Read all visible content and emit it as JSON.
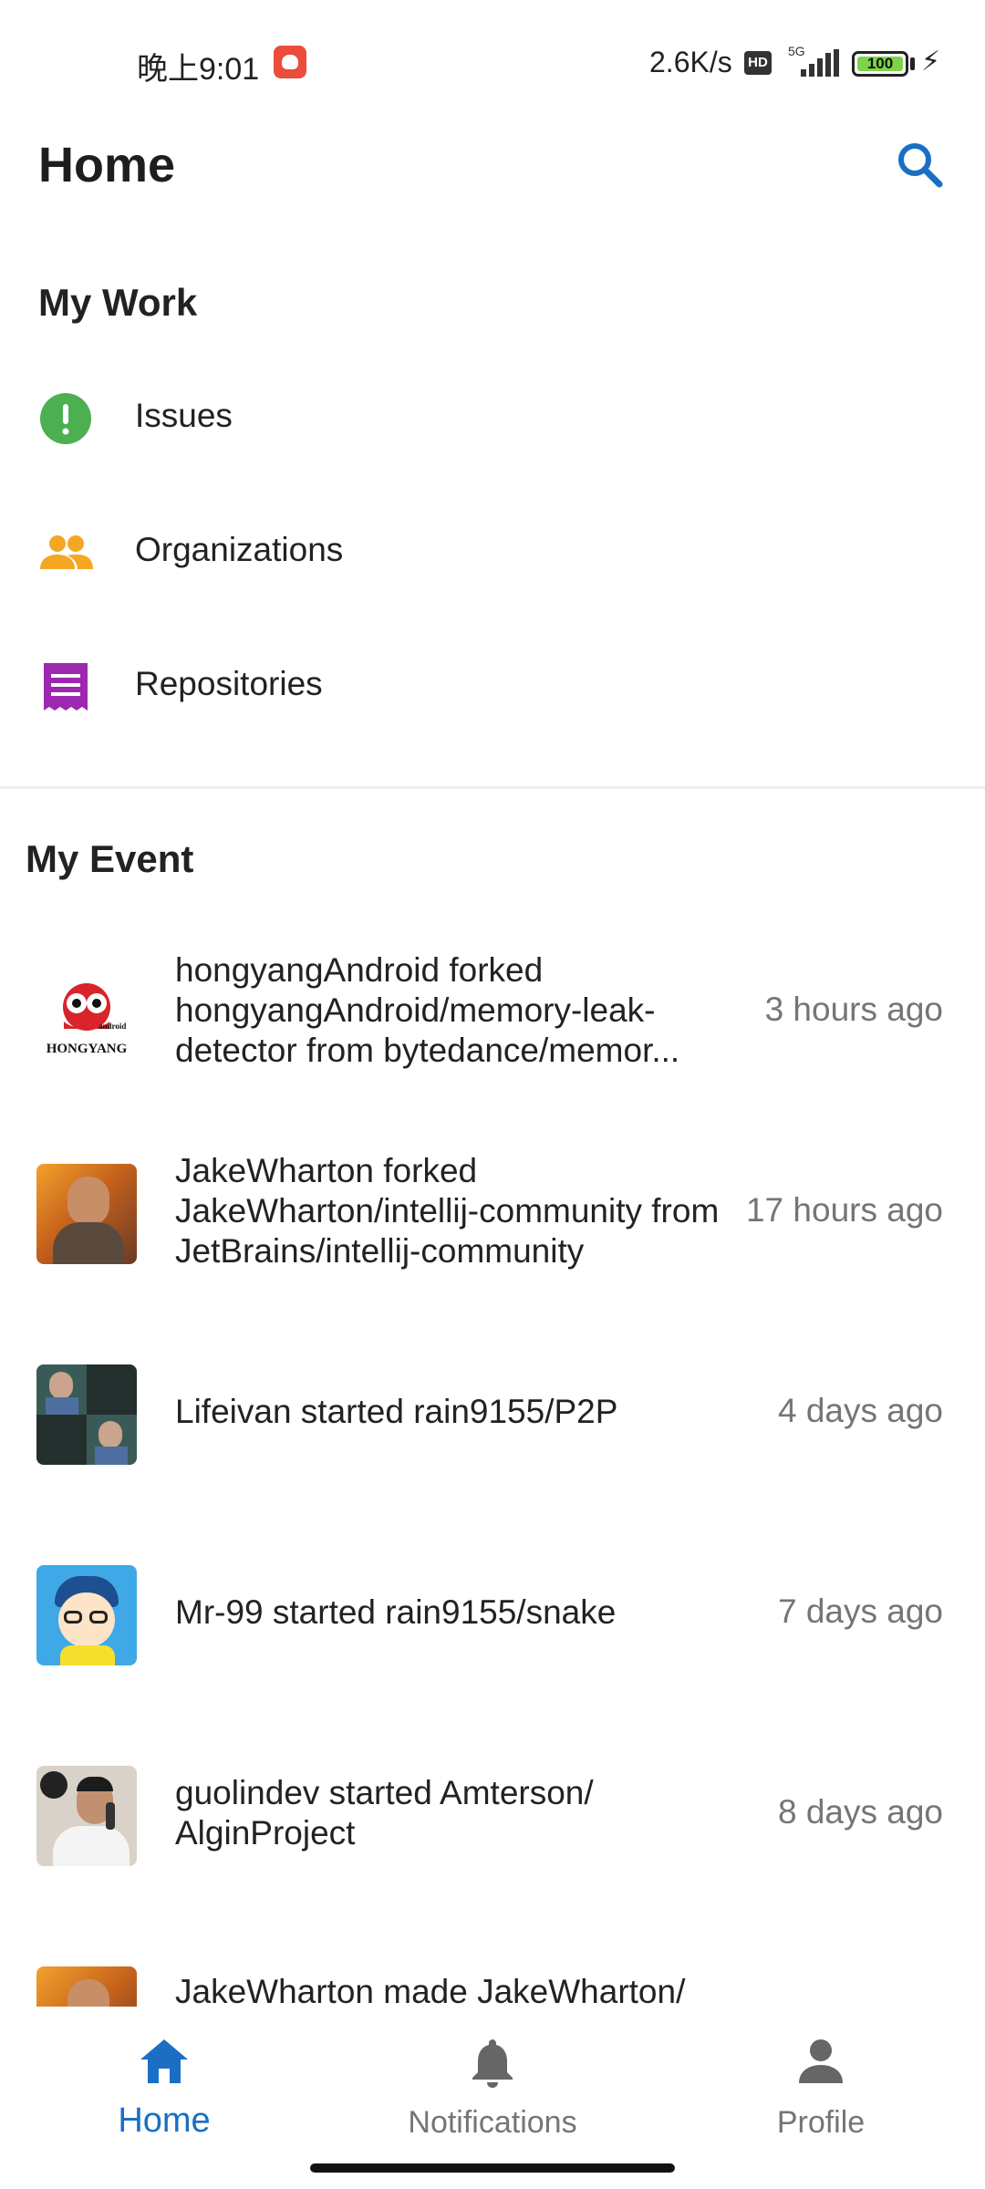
{
  "status_bar": {
    "time": "晚上9:01",
    "net_speed": "2.6K/s",
    "hd": "HD",
    "network": "5G",
    "battery": "100"
  },
  "header": {
    "title": "Home"
  },
  "my_work": {
    "title": "My Work",
    "items": [
      {
        "label": "Issues",
        "icon": "issues-icon",
        "color": "#4caf50"
      },
      {
        "label": "Organizations",
        "icon": "organizations-icon",
        "color": "#f5a623"
      },
      {
        "label": "Repositories",
        "icon": "repositories-icon",
        "color": "#9c27b0"
      }
    ]
  },
  "my_event": {
    "title": "My Event",
    "events": [
      {
        "text": "hongyangAndroid forked hongyangAndroid/memory-leak-detector from bytedance/memor...",
        "time": "3 hours ago",
        "avatar_brand": "HONGYANG",
        "avatar_brand_small": "android"
      },
      {
        "text": "JakeWharton forked JakeWharton/intellij-community from JetBrains/intellij-community",
        "time": "17 hours ago"
      },
      {
        "text": "Lifeivan started rain9155/P2P",
        "time": "4 days ago"
      },
      {
        "text": "Mr-99 started rain9155/snake",
        "time": "7 days ago"
      },
      {
        "text": "guolindev started Amterson/ AlginProject",
        "time": "8 days ago"
      },
      {
        "text": "JakeWharton made JakeWharton/",
        "time": ""
      }
    ]
  },
  "bottom_nav": {
    "items": [
      {
        "label": "Home",
        "icon": "home-icon",
        "active": true
      },
      {
        "label": "Notifications",
        "icon": "bell-icon",
        "active": false
      },
      {
        "label": "Profile",
        "icon": "person-icon",
        "active": false
      }
    ]
  },
  "colors": {
    "accent": "#1a6fc4",
    "secondary_text": "#757575"
  }
}
